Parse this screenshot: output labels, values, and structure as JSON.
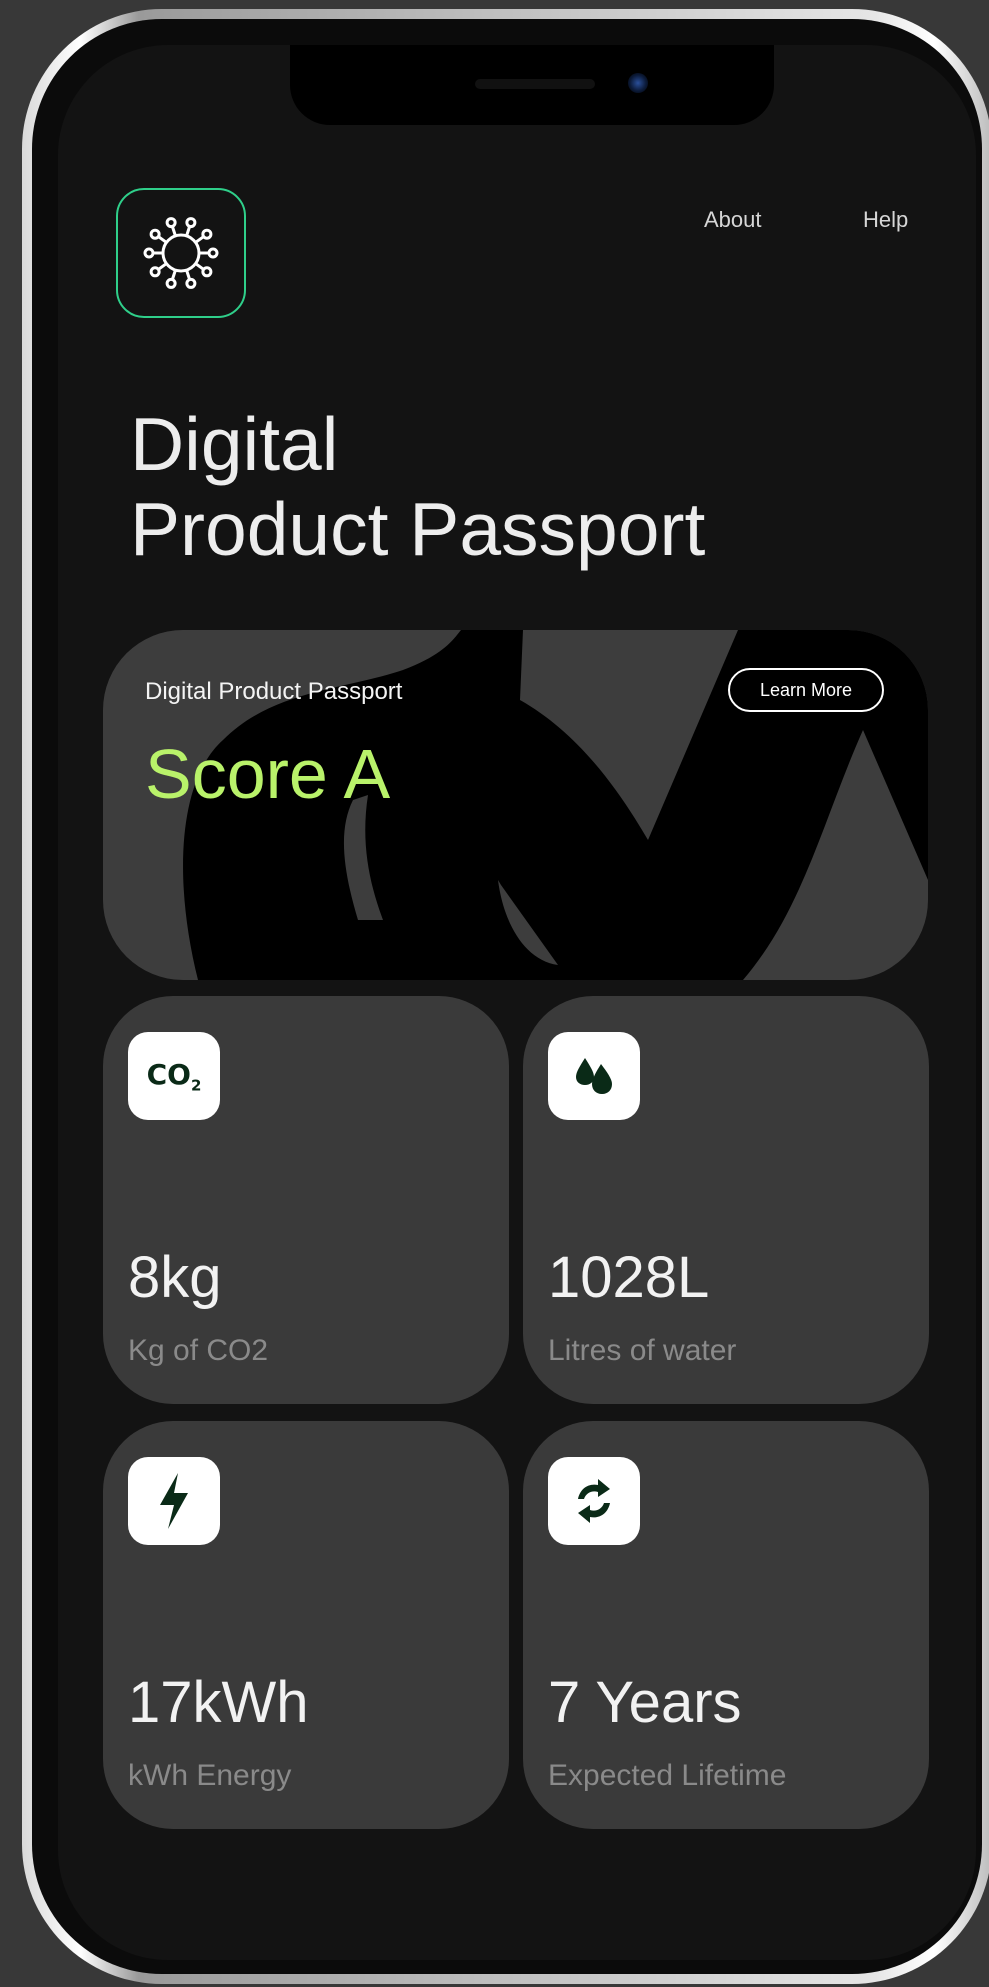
{
  "nav": {
    "about_label": "About",
    "help_label": "Help"
  },
  "title": {
    "line1": "Digital",
    "line2": "Product Passport"
  },
  "score_card": {
    "caption": "Digital Product Passport",
    "learn_more_label": "Learn More",
    "score": "Score A"
  },
  "stats": [
    {
      "icon": "co2-icon",
      "icon_text": "CO",
      "icon_sub": "2",
      "value": "8kg",
      "label": "Kg of CO2"
    },
    {
      "icon": "water-drops-icon",
      "value": "1028L",
      "label": "Litres of water"
    },
    {
      "icon": "lightning-bolt-icon",
      "value": "17kWh",
      "label": "kWh Energy"
    },
    {
      "icon": "recycle-arrows-icon",
      "value": "7 Years",
      "label": "Expected Lifetime"
    }
  ],
  "colors": {
    "background": "#131313",
    "card": "#3a3a3a",
    "accent_logo": "#2fcf8a",
    "score_text": "#b9f26a",
    "icon_fill": "#0a2a17"
  }
}
